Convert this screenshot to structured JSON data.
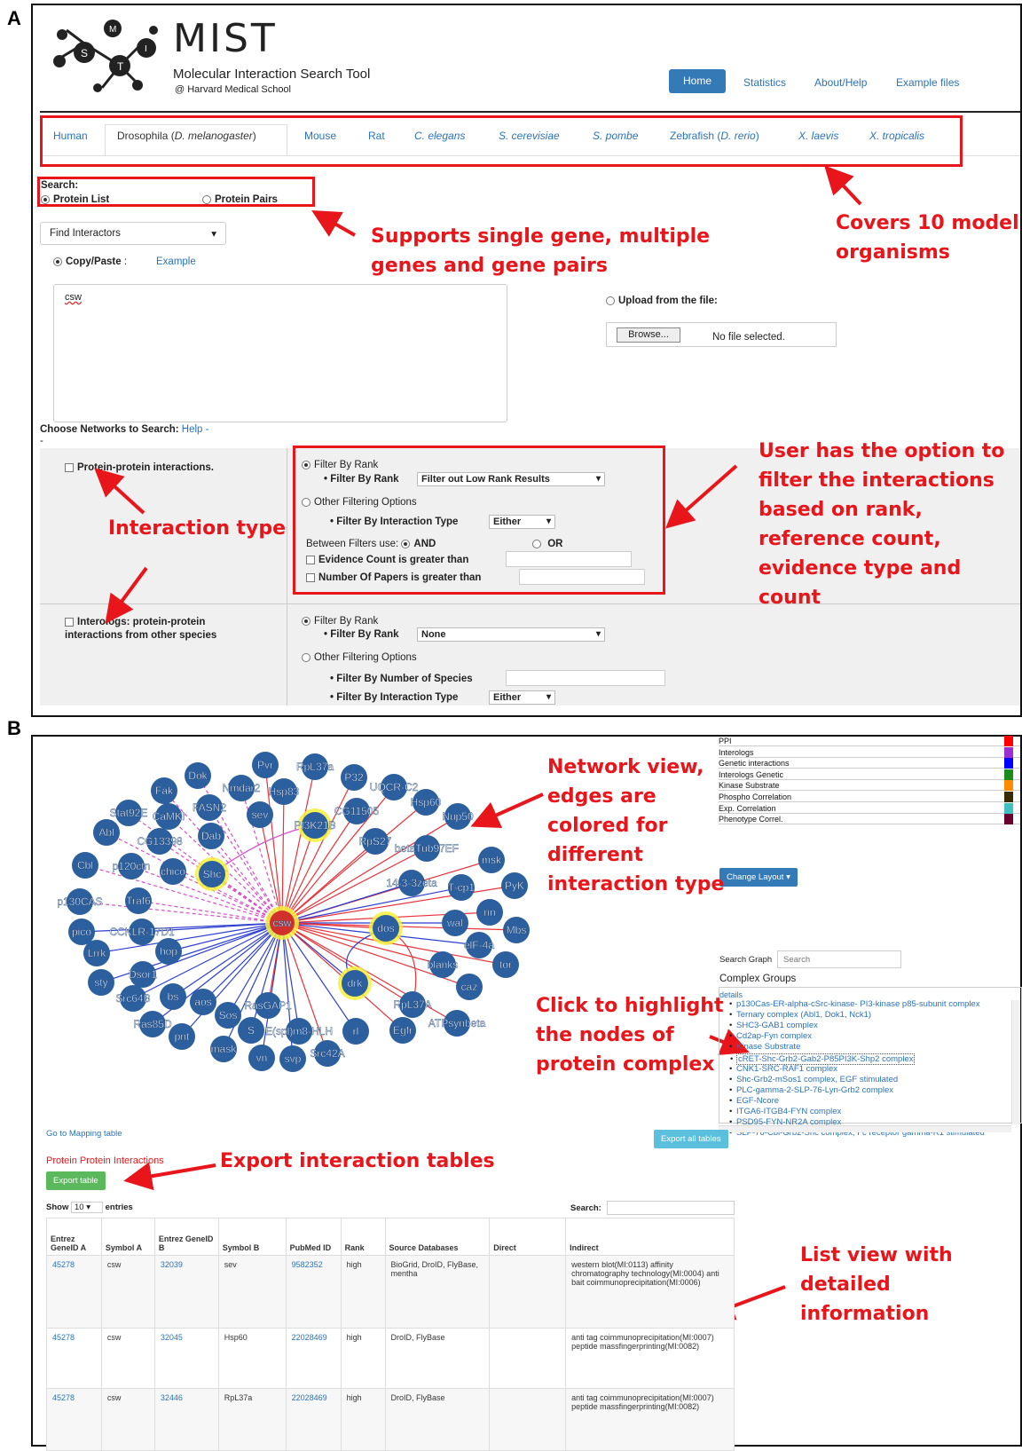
{
  "panels": {
    "a": "A",
    "b": "B"
  },
  "app": {
    "title": "MIST",
    "subtitle": "Molecular Interaction Search Tool",
    "org": "@ Harvard Medical School"
  },
  "nav": {
    "home": "Home",
    "statistics": "Statistics",
    "about": "About/Help",
    "examples": "Example files"
  },
  "organisms": [
    {
      "label": "Human"
    },
    {
      "label": "Drosophila (",
      "italic": "D. melanogaster",
      "tail": ")"
    },
    {
      "label": "Mouse"
    },
    {
      "label": "Rat"
    },
    {
      "italic": "C. elegans"
    },
    {
      "italic": "S. cerevisiae"
    },
    {
      "italic": "S. pombe"
    },
    {
      "label": "Zebrafish (",
      "italic": "D. rerio",
      "tail": ")"
    },
    {
      "italic": "X. laevis"
    },
    {
      "italic": "X. tropicalis"
    }
  ],
  "search": {
    "label": "Search:",
    "protein_list": "Protein List",
    "protein_pairs": "Protein Pairs",
    "mode": "Find Interactors",
    "copy_paste": "Copy/Paste",
    "colon": ":",
    "example": "Example",
    "input_value": "csw",
    "upload": "Upload from the file:",
    "browse": "Browse...",
    "no_file": "No file selected.",
    "choose_networks": "Choose Networks to Search:",
    "help": "Help -",
    "dash": "-"
  },
  "ppi_section": {
    "title": "Protein-protein interactions.",
    "filter_by_rank": "Filter By Rank",
    "filter_by_rank_label": "Filter By Rank",
    "filter_by_rank_value": "Filter out Low Rank Results",
    "other_filtering": "Other Filtering Options",
    "interaction_type_label": "Filter By Interaction Type",
    "interaction_type_value": "Either",
    "between_filters": "Between Filters use:",
    "and": "AND",
    "or": "OR",
    "evidence_count": "Evidence Count is greater than",
    "papers": "Number Of Papers is greater than"
  },
  "interologs_section": {
    "title": "Interologs: protein-protein",
    "title2": "interactions from other species",
    "filter_by_rank": "Filter By Rank",
    "filter_by_rank_label": "Filter By Rank",
    "filter_by_rank_value": "None",
    "other_filtering": "Other Filtering Options",
    "num_species": "Filter By Number of Species",
    "interaction_type_label": "Filter By Interaction Type",
    "interaction_type_value": "Either"
  },
  "annotations": {
    "single_gene_1": "Supports single gene, multiple",
    "single_gene_2": "genes and gene pairs",
    "organisms_1": "Covers 10 model",
    "organisms_2": "organisms",
    "filter_1": "User has the option to",
    "filter_2": "filter the interactions",
    "filter_3": "based on rank,",
    "filter_4": "reference count,",
    "filter_5": "evidence type and",
    "filter_6": "count",
    "interaction_type": "Interaction type",
    "network_1": "Network view,",
    "network_2": "edges are",
    "network_3": "colored for",
    "network_4": "different",
    "network_5": "interaction type",
    "highlight_1": "Click to highlight",
    "highlight_2": "the nodes of",
    "highlight_3": "protein complex",
    "export": "Export interaction tables",
    "list_1": "List view with",
    "list_2": "detailed",
    "list_3": "information"
  },
  "legend": [
    {
      "label": "PPI",
      "color": "#ff0000"
    },
    {
      "label": "Interologs",
      "color": "#9b30d0"
    },
    {
      "label": "Genetic interactions",
      "color": "#0000ff"
    },
    {
      "label": "Interologs Genetic",
      "color": "#1a8c1a"
    },
    {
      "label": "Kinase Substrate",
      "color": "#ff8c00"
    },
    {
      "label": "Phospho Correlation",
      "color": "#3a2a00"
    },
    {
      "label": "Exp. Correlation",
      "color": "#40c0c0"
    },
    {
      "label": "Phenotype Correl.",
      "color": "#6a0030"
    }
  ],
  "graph": {
    "change_layout": "Change Layout ▾",
    "search_graph": "Search Graph",
    "search_placeholder": "Search",
    "complex_groups": "Complex Groups",
    "details": "details",
    "complexes": [
      "p130Cas-ER-alpha-cSrc-kinase- PI3-kinase p85-subunit complex",
      "Ternary complex (Abl1, Dok1, Nck1)",
      "SHC3-GAB1 complex",
      "Cd2ap-Fyn complex",
      "Kinase Substrate",
      "cRET-Shc-Grb2-Gab2-P85PI3K-Shp2 complex",
      "CNK1-SRC-RAF1 complex",
      "Shc-Grb2-mSos1 complex, EGF stimulated",
      "PLC-gamma-2-SLP-76-Lyn-Grb2 complex",
      "EGF-Ncore",
      "ITGA6-ITGB4-FYN complex",
      "PSD95-FYN-NR2A complex",
      "SLP-76-Cbl-Grb2-Shc complex, Fc receptor gamma-R1 stimulated"
    ],
    "center": "csw",
    "nodes": [
      "Pvr",
      "RpL37a",
      "P32",
      "UQCR-C2",
      "Hsp60",
      "Nup50",
      "Dok",
      "Nmdar2",
      "Hsp83",
      "Fak",
      "FASN2",
      "sev",
      "PI3K21B",
      "CG11505",
      "Stat92E",
      "CaMKI",
      "Abl",
      "CG13398",
      "Dab",
      "RpS27",
      "betaTub97EF",
      "msk",
      "Cbl",
      "p120ctn",
      "chico",
      "Shc",
      "14-3-3zeta",
      "T-cp1",
      "PyK",
      "p130CAS",
      "Traf6",
      "rin",
      "wal",
      "Mbs",
      "pico",
      "CCKLR-17D1",
      "dos",
      "elF-4a",
      "Lrrk",
      "hop",
      "blanks",
      "tor",
      "sty",
      "Dsor1",
      "drk",
      "caz",
      "Src64B",
      "bs",
      "aos",
      "RasGAP1",
      "RpL37A",
      "Ras85D",
      "Sos",
      "S",
      "E(spl)m8-HLH",
      "rl",
      "Egfr",
      "ATPsynbeta",
      "pnt",
      "mask",
      "vn",
      "svp",
      "Src42A"
    ]
  },
  "table": {
    "mapping_link": "Go to Mapping table",
    "export_all": "Export all tables",
    "section_title": "Protein Protein Interactions",
    "export_table": "Export table",
    "show": "Show",
    "show_value": "10",
    "entries": "entries",
    "search": "Search:",
    "headers": [
      "Entrez GeneID A",
      "Symbol A",
      "Entrez GeneID B",
      "Symbol B",
      "PubMed ID",
      "Rank",
      "Source Databases",
      "Direct",
      "Indirect"
    ],
    "rows": [
      [
        "45278",
        "csw",
        "32039",
        "sev",
        "9582352",
        "high",
        "BioGrid, DroID, FlyBase, mentha",
        "",
        "western blot(MI:0113) affinity chromatography technology(MI:0004) anti bait coimmunoprecipitation(MI:0006)"
      ],
      [
        "45278",
        "csw",
        "32045",
        "Hsp60",
        "22028469",
        "high",
        "DroID, FlyBase",
        "",
        "anti tag coimmunoprecipitation(MI:0007) peptide massfingerprinting(MI:0082)"
      ],
      [
        "45278",
        "csw",
        "32446",
        "RpL37a",
        "22028469",
        "high",
        "DroID, FlyBase",
        "",
        "anti tag coimmunoprecipitation(MI:0007) peptide massfingerprinting(MI:0082)"
      ]
    ]
  }
}
